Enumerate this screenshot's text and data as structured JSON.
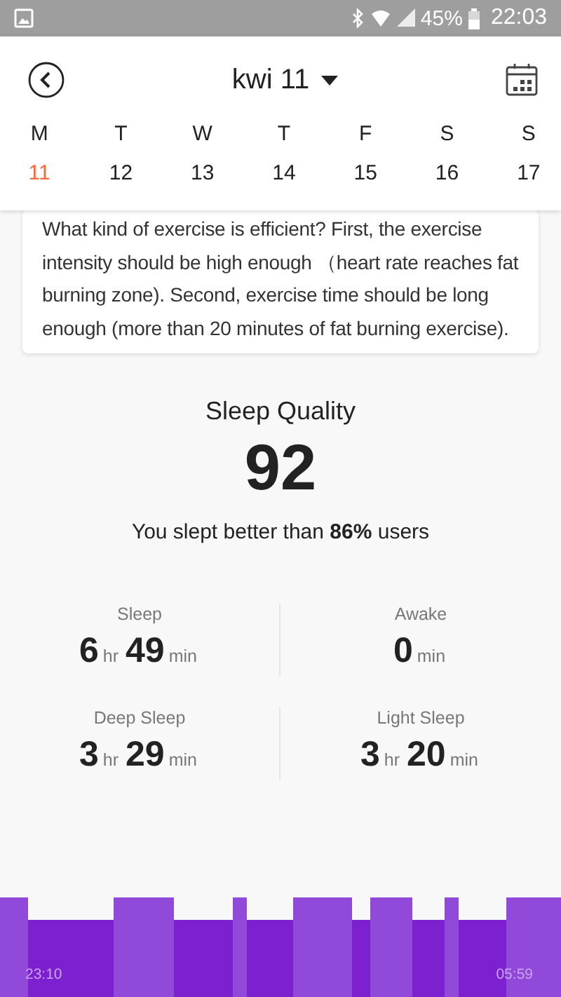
{
  "status_bar": {
    "battery": "45%",
    "time": "22:03"
  },
  "header": {
    "title": "kwi 11"
  },
  "week": [
    {
      "weekday": "M",
      "date": "11",
      "selected": true
    },
    {
      "weekday": "T",
      "date": "12",
      "selected": false
    },
    {
      "weekday": "W",
      "date": "13",
      "selected": false
    },
    {
      "weekday": "T",
      "date": "14",
      "selected": false
    },
    {
      "weekday": "F",
      "date": "15",
      "selected": false
    },
    {
      "weekday": "S",
      "date": "16",
      "selected": false
    },
    {
      "weekday": "S",
      "date": "17",
      "selected": false
    }
  ],
  "tip_card": {
    "text": "What kind of exercise is efficient? First, the exercise intensity should be high enough （heart rate reaches fat burning zone). Second, exercise time should be long enough (more than 20 minutes of fat burning exercise)."
  },
  "sleep_quality": {
    "label": "Sleep Quality",
    "score": "92",
    "comparison": "You slept better than **86%** users"
  },
  "stats": [
    {
      "label": "Sleep",
      "parts": [
        {
          "value": "6",
          "unit": "hr"
        },
        {
          "value": "49",
          "unit": "min"
        }
      ]
    },
    {
      "label": "Awake",
      "parts": [
        {
          "value": "0",
          "unit": "min"
        }
      ]
    },
    {
      "label": "Deep Sleep",
      "parts": [
        {
          "value": "3",
          "unit": "hr"
        },
        {
          "value": "29",
          "unit": "min"
        }
      ]
    },
    {
      "label": "Light Sleep",
      "parts": [
        {
          "value": "3",
          "unit": "hr"
        },
        {
          "value": "20",
          "unit": "min"
        }
      ]
    }
  ],
  "sleep_chart": {
    "start_time": "23:10",
    "end_time": "05:59"
  }
}
